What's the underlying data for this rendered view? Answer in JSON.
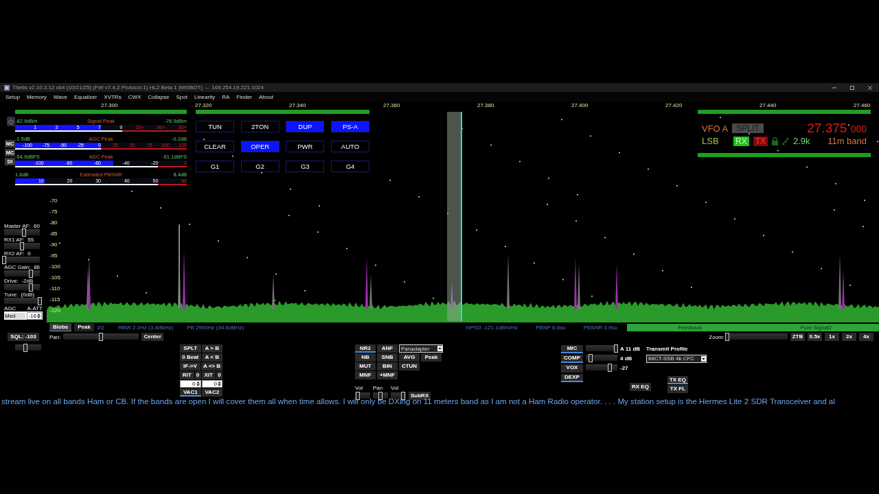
{
  "window": {
    "title": "Thetis v2.10.3.12 x64 (10/21/25) (FW v7.4.2 Protocol 1) HL2 Beta 1 (MI0BOT)  –  169.254.19.221:1024"
  },
  "menu": [
    "Setup",
    "Memory",
    "Wave",
    "Equalizer",
    "XVTRs",
    "CWX",
    "Collapse",
    "Spot",
    "Linearity",
    "RA",
    "Finder",
    "About"
  ],
  "side_tabs": [
    "MC",
    "MC",
    "DI"
  ],
  "meters": [
    {
      "left": "-82.9dBm",
      "title": "Signal Peak",
      "right": "-76.9dBm",
      "level": 0.5,
      "ticks": [
        {
          "label": "1",
          "over": false
        },
        {
          "label": "3",
          "over": false
        },
        {
          "label": "5",
          "over": false
        },
        {
          "label": "7",
          "over": false
        },
        {
          "label": "9",
          "over": false
        },
        {
          "label": "20+",
          "over": true
        },
        {
          "label": "40+",
          "over": true
        },
        {
          "label": "60+",
          "over": true
        }
      ]
    },
    {
      "left": "-1.5dB",
      "title": "AGC Peak",
      "right": "-0.2dB",
      "level": 0.5,
      "ticks": [
        {
          "label": "-100",
          "over": false
        },
        {
          "label": "-75",
          "over": false
        },
        {
          "label": "-50",
          "over": false
        },
        {
          "label": "-25",
          "over": false
        },
        {
          "label": "0",
          "over": false
        },
        {
          "label": "25",
          "over": true
        },
        {
          "label": "50",
          "over": true
        },
        {
          "label": "75",
          "over": true
        },
        {
          "label": "100",
          "over": true
        },
        {
          "label": "125",
          "over": true
        }
      ]
    },
    {
      "left": "-54.9dBFS",
      "title": "ADC Peak",
      "right": "-51.1dBFS",
      "level": 0.57,
      "ticks": [
        {
          "label": "-100",
          "over": false
        },
        {
          "label": "-80",
          "over": false
        },
        {
          "label": "-60",
          "over": false
        },
        {
          "label": "-40",
          "over": false
        },
        {
          "label": "-20",
          "over": false
        },
        {
          "label": "0",
          "over": true
        }
      ]
    },
    {
      "left": "1.6dB",
      "title": "Estimated PBSNR",
      "right": "8.4dB",
      "level": 0.17,
      "ticks": [
        {
          "label": "10",
          "over": false
        },
        {
          "label": "20",
          "over": false
        },
        {
          "label": "30",
          "over": false
        },
        {
          "label": "40",
          "over": false
        },
        {
          "label": "50",
          "over": false
        },
        {
          "label": "60",
          "over": true
        }
      ]
    }
  ],
  "sliders": [
    {
      "label": "Master AF:  60",
      "level": 0.55
    },
    {
      "label": "RX1 AF:  55",
      "level": 0.5
    },
    {
      "label": "RX2 AF:  0",
      "level": 0
    },
    {
      "label": "AGC Gain:  86",
      "level": 0.75
    },
    {
      "label": "Drive:  -2dB",
      "level": 0.75
    },
    {
      "label": "Tune:  (0dB)",
      "level": 1
    }
  ],
  "agc": {
    "label": "AGC",
    "att_label": "A-ATT",
    "mode": "Med",
    "att": "-16"
  },
  "squelch": {
    "label": "SQL: -103",
    "level": 0.4
  },
  "freq_scale": [
    "27.300",
    "27.320",
    "27.340",
    "27.360",
    "27.380",
    "27.400",
    "27.420",
    "27.440",
    "27.460"
  ],
  "db_scale": [
    "-70",
    "-75",
    "-80",
    "-85",
    "-90",
    "-95",
    "-100",
    "-105",
    "-110",
    "-115",
    "-120"
  ],
  "function_buttons": [
    {
      "label": "TUN",
      "on": false
    },
    {
      "label": "2TON",
      "on": false
    },
    {
      "label": "DUP",
      "on": true
    },
    {
      "label": "PS-A",
      "on": true
    },
    {
      "label": "CLEAR",
      "on": false
    },
    {
      "label": "OPER",
      "on": true
    },
    {
      "label": "PWR",
      "on": false
    },
    {
      "label": "AUTO",
      "on": false
    },
    {
      "label": "G1",
      "on": false
    },
    {
      "label": "G2",
      "on": false
    },
    {
      "label": "G3",
      "on": false
    },
    {
      "label": "G4",
      "on": false
    }
  ],
  "vfo": {
    "name": "VFO A",
    "split": {
      "label": "SPLIT",
      "on": false
    },
    "freq_main": "27.375",
    "freq_sub": "000",
    "mode": "LSB",
    "rx": {
      "label": "RX",
      "on": true
    },
    "tx": {
      "label": "TX",
      "on": false
    },
    "bandwidth": "2.9k",
    "band": "11m band"
  },
  "display_bar": {
    "buttons": [
      {
        "label": "Blobs",
        "selected": true
      },
      {
        "label": "Peak",
        "selected": false
      }
    ],
    "page": "2/2",
    "rbw_readouts": [
      "RBW 2.2Hz (3.4dBHz)",
      "PB 2900Hz (34.6dBHz)"
    ],
    "noise_readouts": [
      "NPSD -121.1dBm/Hz",
      "PBNP 6.8su",
      "PBSNR 0.9su"
    ],
    "ps_tabs": [
      "Feedback",
      "Pure Signal2"
    ]
  },
  "pan": {
    "label": "Pan:",
    "level": 0.5,
    "center": "Center"
  },
  "zoom": {
    "label": "Zoom:",
    "level": 0,
    "buttons": [
      "ZTB",
      "0.5x",
      "1x",
      "2x",
      "4x"
    ]
  },
  "vfo_rows": [
    [
      {
        "kind": "button",
        "label": "SPLT",
        "on": false
      },
      {
        "kind": "button",
        "label": "A > B",
        "on": false
      }
    ],
    [
      {
        "kind": "button",
        "label": "0 Beat",
        "on": false
      },
      {
        "kind": "button",
        "label": "A < B",
        "on": false
      }
    ],
    [
      {
        "kind": "button",
        "label": "IF->V",
        "on": false
      },
      {
        "kind": "button",
        "label": "A <> B",
        "on": false
      }
    ],
    [
      {
        "kind": "button",
        "label": "RIT",
        "on": false
      },
      {
        "kind": "value",
        "label": "0"
      },
      {
        "kind": "button",
        "label": "XIT",
        "on": false
      },
      {
        "kind": "value",
        "label": "0"
      }
    ],
    [
      {
        "kind": "spinner",
        "label": "0"
      },
      {
        "kind": "spinner",
        "label": "0"
      }
    ],
    [
      {
        "kind": "button",
        "label": "VAC1",
        "on": true
      },
      {
        "kind": "button",
        "label": "VAC2",
        "on": false
      }
    ]
  ],
  "dsp_rows": [
    [
      {
        "kind": "button",
        "label": "NR2",
        "on": true
      },
      {
        "kind": "button",
        "label": "ANF",
        "on": false
      },
      {
        "kind": "dropdown",
        "label": "Panadapter"
      }
    ],
    [
      {
        "kind": "button",
        "label": "NB",
        "on": false
      },
      {
        "kind": "button",
        "label": "SNB",
        "on": false
      },
      {
        "kind": "button",
        "label": "AVG",
        "on": false
      },
      {
        "kind": "button",
        "label": "Peak",
        "on": false
      }
    ],
    [
      {
        "kind": "button",
        "label": "MUT",
        "on": false
      },
      {
        "kind": "button",
        "label": "BIN",
        "on": false
      },
      {
        "kind": "button",
        "label": "CTUN",
        "on": false
      }
    ],
    [
      {
        "kind": "button",
        "label": "MNF",
        "on": false
      },
      {
        "kind": "button",
        "label": "+MNF",
        "on": false
      }
    ]
  ],
  "mixer": {
    "sliders": [
      {
        "label": "Vol",
        "level": 0.2
      },
      {
        "label": "Pan",
        "level": 0.5
      },
      {
        "label": "Vol",
        "level": 0.8
      }
    ],
    "subrx": "SubRX"
  },
  "tx": {
    "rows": [
      {
        "label": "MIC",
        "on": true,
        "level": 0.95,
        "value": "A 11 dB"
      },
      {
        "label": "COMP",
        "on": true,
        "level": 0.15,
        "value": "4 dB"
      },
      {
        "label": "VOX",
        "on": false,
        "level": 0.75,
        "value": "-27"
      },
      {
        "label": "DEXP",
        "on": true
      }
    ],
    "profile_label": "Transmit Profile",
    "profile": "68CT-SSB 4k CFC",
    "eq_buttons": [
      {
        "label": "RX EQ",
        "on": false
      },
      {
        "label": "TX EQ",
        "on": true
      },
      {
        "label": "TX FL",
        "on": false
      }
    ]
  },
  "ticker": "stream live on all bands Ham or CB. If the bands are open I will cover them all when time allows. I will only be DXing on 11 meters band as I am not a Ham Radio operator.    . . . My station setup is the Hermes Lite 2 SDR Transceiver and al"
}
